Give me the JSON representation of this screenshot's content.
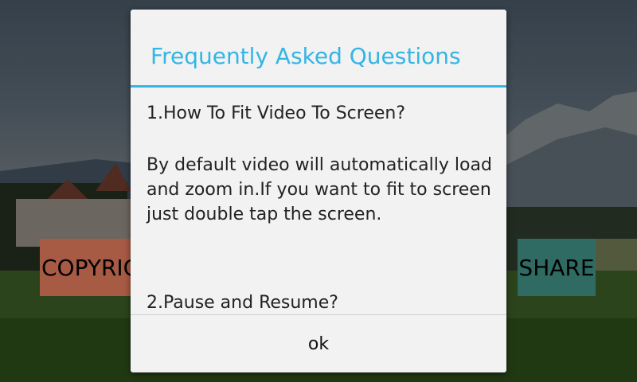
{
  "background": {
    "left_button_label": "COPYRIGHT",
    "right_button_label": "SHARE",
    "left_button_color": "#a75a44",
    "right_button_color": "#2f6b63"
  },
  "dialog": {
    "title": "Frequently Asked Questions",
    "accent_color": "#33b5e5",
    "faq": [
      {
        "question": "1.How To Fit Video To Screen?",
        "answer": "By default video will automatically load and zoom in.If you want to fit to screen just double tap the screen."
      },
      {
        "question": "2.Pause and Resume?"
      }
    ],
    "ok_label": "ok"
  }
}
